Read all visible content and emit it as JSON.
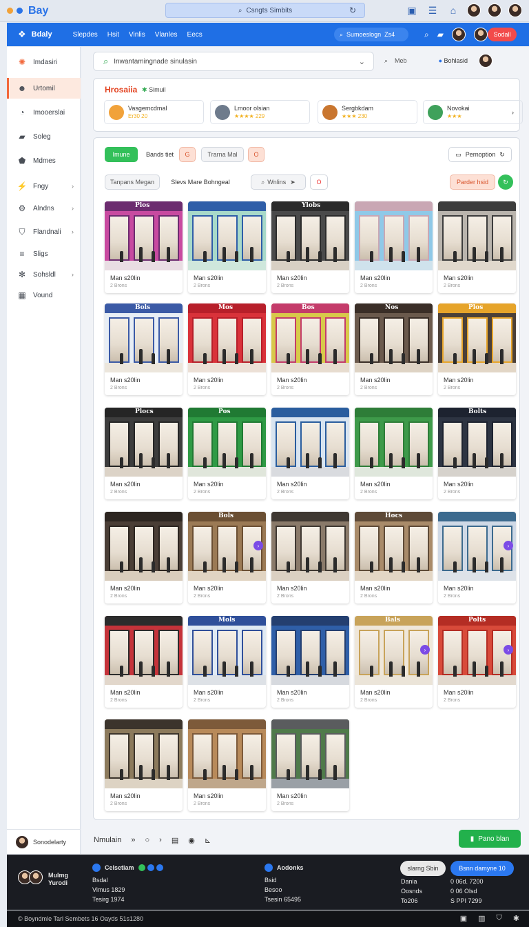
{
  "window": {
    "app_title": "Bay",
    "address": "Csngts Simbits",
    "icons": [
      "reload-icon",
      "panel-icon",
      "tray-icon",
      "bag-icon"
    ]
  },
  "navbar": {
    "brand": "Bdaly",
    "links": [
      "Slepdes",
      "Hsit",
      "Vinlis",
      "Vlanles",
      "Eecs"
    ],
    "search_text": "Sumoeslogn",
    "search_badge": "Zs4",
    "action_button": "Sodall"
  },
  "sidebar": {
    "items": [
      {
        "label": "Imdasiri",
        "icon": "burst-icon",
        "active": false,
        "chevron": false
      },
      {
        "label": "Urtomil",
        "icon": "avatar-icon",
        "active": true,
        "chevron": false
      },
      {
        "label": "Imooerslai",
        "icon": "notification-icon",
        "active": false,
        "chevron": false
      },
      {
        "label": "Soleg",
        "icon": "bag-icon",
        "active": false,
        "chevron": false
      },
      {
        "label": "Mdmes",
        "icon": "tag-icon",
        "active": false,
        "chevron": false
      },
      {
        "label": "Fngy",
        "icon": "bolt-icon",
        "active": false,
        "chevron": true
      },
      {
        "label": "Alndns",
        "icon": "settings-icon",
        "active": false,
        "chevron": true
      },
      {
        "label": "Flandnali",
        "icon": "shield-icon",
        "active": false,
        "chevron": true
      },
      {
        "label": "Sligs",
        "icon": "sliders-icon",
        "active": false,
        "chevron": false
      },
      {
        "label": "Sohsldl",
        "icon": "gear-icon",
        "active": false,
        "chevron": true
      },
      {
        "label": "Vound",
        "icon": "grid-icon",
        "active": false,
        "chevron": false
      }
    ],
    "user_label": "Sonodelarty"
  },
  "search": {
    "value": "Inwantamingnade sinulasin",
    "right_label_1": "Meb",
    "right_label_2": "Bohlasid"
  },
  "featured": {
    "title": "Hrosaiia",
    "subtitle": "Simuil",
    "cards": [
      {
        "title": "Vasgemcdmal",
        "meta": "Er30 20",
        "color": "#f1a23a"
      },
      {
        "title": "Lmoor olsian",
        "meta": "★★★★ 229",
        "color": "#6e7b8c"
      },
      {
        "title": "Sergbkdam",
        "meta": "★★★ 230",
        "color": "#c9762f"
      },
      {
        "title": "Novokai",
        "meta": "★★★",
        "color": "#3fa15b"
      }
    ]
  },
  "filters": {
    "row1": [
      "Imune",
      "Bands tiet",
      "G",
      "Trarna Mal",
      "O"
    ],
    "row2": [
      "Tanpans Megan",
      "Slevs Mare Bohngeal",
      "Wnlins",
      "O"
    ],
    "promo": "Pernoption",
    "right_pill": "Parder hsid"
  },
  "grid": {
    "items": [
      {
        "title": "Man s20lin",
        "meta": "2 Brons",
        "wall": "#c84aa0",
        "front": "#6c2c6f",
        "text": "Plos",
        "floor": "#e9dde3",
        "play": false
      },
      {
        "title": "Man s20lin",
        "meta": "2 Brons",
        "wall": "#a8d9c9",
        "front": "#2f5ea8",
        "text": "",
        "floor": "#cfe7dc",
        "play": false
      },
      {
        "title": "Man s20lin",
        "meta": "2 Brons",
        "wall": "#4a4a4a",
        "front": "#2b2b2b",
        "text": "Ylobs",
        "floor": "#d8d0c4",
        "play": false
      },
      {
        "title": "Man s20lin",
        "meta": "2 Brons",
        "wall": "#8fc9e8",
        "front": "#c9a7b4",
        "text": "",
        "floor": "#cfe2ec",
        "play": false
      },
      {
        "title": "Man s20lin",
        "meta": "2 Brons",
        "wall": "#b9b4ad",
        "front": "#3d3d3d",
        "text": "",
        "floor": "#e0d8cc",
        "play": false
      },
      {
        "title": "Man s20lin",
        "meta": "2 Brons",
        "wall": "#e8eef5",
        "front": "#3b5aa6",
        "text": "Bols",
        "floor": "#ece6dc",
        "play": false
      },
      {
        "title": "Man s20lin",
        "meta": "2 Brons",
        "wall": "#d9323a",
        "front": "#b71f2a",
        "text": "Mos",
        "floor": "#ece0d6",
        "play": false
      },
      {
        "title": "Man s20lin",
        "meta": "2 Brons",
        "wall": "#d8c94a",
        "front": "#c43b6a",
        "text": "Bos",
        "floor": "#e7dccf",
        "play": false
      },
      {
        "title": "Man s20lin",
        "meta": "2 Brons",
        "wall": "#6b5a4d",
        "front": "#3a2e27",
        "text": "Nos",
        "floor": "#ded3c4",
        "play": false
      },
      {
        "title": "Man s20lin",
        "meta": "2 Brons",
        "wall": "#4b4038",
        "front": "#e6a42a",
        "text": "Plos",
        "floor": "#e2d6c6",
        "play": false
      },
      {
        "title": "Man s20lin",
        "meta": "2 Brons",
        "wall": "#3d3d3d",
        "front": "#252525",
        "text": "Plocs",
        "floor": "#dcd3c7",
        "play": false
      },
      {
        "title": "Man s20lin",
        "meta": "2 Brons",
        "wall": "#2f9a45",
        "front": "#207a33",
        "text": "Pos",
        "floor": "#e0e6db",
        "play": false
      },
      {
        "title": "Man s20lin",
        "meta": "2 Brons",
        "wall": "#d8e4f0",
        "front": "#2a5d9e",
        "text": "",
        "floor": "#d9dbdf",
        "play": false
      },
      {
        "title": "Man s20lin",
        "meta": "2 Brons",
        "wall": "#3e9a4a",
        "front": "#2e7d38",
        "text": "",
        "floor": "#dfe7dc",
        "play": false
      },
      {
        "title": "Man s20lin",
        "meta": "2 Brons",
        "wall": "#2d3442",
        "front": "#1d2330",
        "text": "Bolts",
        "floor": "#d6d2cc",
        "play": false
      },
      {
        "title": "Man s20lin",
        "meta": "2 Brons",
        "wall": "#4a3e36",
        "front": "#2c2520",
        "text": "",
        "floor": "#d9cdbd",
        "play": false
      },
      {
        "title": "Man s20lin",
        "meta": "2 Brons",
        "wall": "#9b7a55",
        "front": "#6b4f33",
        "text": "Bols",
        "floor": "#e1d4c2",
        "play": true
      },
      {
        "title": "Man s20lin",
        "meta": "2 Brons",
        "wall": "#8a7a6a",
        "front": "#3f3832",
        "text": "",
        "floor": "#dbd0c2",
        "play": false
      },
      {
        "title": "Man s20lin",
        "meta": "2 Brons",
        "wall": "#a98b6a",
        "front": "#5e4a37",
        "text": "Hocs",
        "floor": "#e3d6c5",
        "play": false
      },
      {
        "title": "Man s20lin",
        "meta": "2 Brons",
        "wall": "#cfd9e6",
        "front": "#3c6a8e",
        "text": "",
        "floor": "#dde2e8",
        "play": true
      },
      {
        "title": "Man s20lin",
        "meta": "2 Brons",
        "wall": "#c5333a",
        "front": "#2c2c2c",
        "text": "",
        "floor": "#e2d7cb",
        "play": false
      },
      {
        "title": "Man s20lin",
        "meta": "2 Brons",
        "wall": "#dfe9f3",
        "front": "#2f4f9a",
        "text": "Mols",
        "floor": "#dde1e6",
        "play": false
      },
      {
        "title": "Man s20lin",
        "meta": "2 Brons",
        "wall": "#2f5fa8",
        "front": "#243f70",
        "text": "",
        "floor": "#d6d9de",
        "play": false
      },
      {
        "title": "Man s20lin",
        "meta": "2 Brons",
        "wall": "#efe7da",
        "front": "#c8a35a",
        "text": "Bals",
        "floor": "#ebe4d8",
        "play": true
      },
      {
        "title": "Man s20lin",
        "meta": "2 Brons",
        "wall": "#d84a3a",
        "front": "#b42d24",
        "text": "Polts",
        "floor": "#e2d9ce",
        "play": true
      },
      {
        "title": "Man s20lin",
        "meta": "2 Brons",
        "wall": "#8c7a5c",
        "front": "#3c342c",
        "text": "",
        "floor": "#ddd3c3",
        "play": false
      },
      {
        "title": "Man s20lin",
        "meta": "2 Brons",
        "wall": "#b88a5a",
        "front": "#7d5a3a",
        "text": "",
        "floor": "#bfa78b",
        "play": false
      },
      {
        "title": "Man s20lin",
        "meta": "2 Brons",
        "wall": "#4f7a4a",
        "front": "#5a5c5e",
        "text": "",
        "floor": "#9aa0a6",
        "play": false
      }
    ]
  },
  "bottom": {
    "label": "Nmulain",
    "button": "Pano blan"
  },
  "footer": {
    "name_line1": "Mulmg",
    "name_line2": "Yurodi",
    "col1": {
      "title": "Celsetiam",
      "lines": [
        "Bsdal",
        "Vimus 1829",
        "Tesirg 1974"
      ]
    },
    "col2": {
      "title": "Aodonks",
      "lines": [
        "Bsid",
        "Besoo",
        "Tsesin 65495"
      ]
    },
    "col3": {
      "lines": [
        "Dania",
        "Oosnds",
        "To206"
      ]
    },
    "col4": {
      "lines": [
        "0 06d. 7200",
        "0 06 Olsd",
        "S PPI 7299"
      ]
    },
    "btn_grey": "slarng Sbin",
    "btn_blue": "Bsnn damyne 10",
    "status": "© Boyndmle Tarl Sembets 16 Oayds 51s1280"
  }
}
